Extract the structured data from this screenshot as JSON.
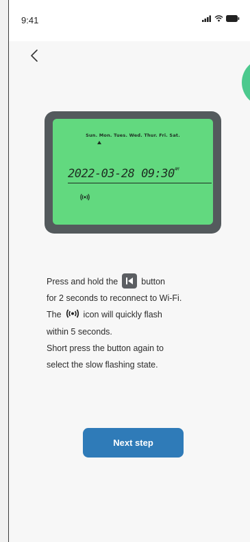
{
  "status_bar": {
    "time": "9:41"
  },
  "icons": {
    "back": "chevron-left-icon",
    "signal": "signal-icon",
    "wifi": "wifi-icon",
    "battery": "battery-icon",
    "wireless_indicator": "wireless-icon",
    "previous_key": "previous-key-icon"
  },
  "device_display": {
    "days": "Sun. Mon. Tues. Wed. Thur. Fri. Sat.",
    "datetime": "2022-03-28 09:30",
    "am_marker": "AM"
  },
  "instructions": {
    "line1_pre": "Press and hold the",
    "line1_post": "button",
    "line2": "for 2 seconds to reconnect to Wi-Fi.",
    "line3_pre": "The",
    "line3_post": "icon will quickly flash",
    "line4": "within 5 seconds.",
    "line5": "Short press the button again to",
    "line6": "select the slow flashing state."
  },
  "actions": {
    "next_label": "Next step"
  },
  "colors": {
    "lcd_green": "#62d97f",
    "accent_green": "#4cc98e",
    "button_blue": "#2f7bb8",
    "frame_gray": "#545a5d"
  }
}
